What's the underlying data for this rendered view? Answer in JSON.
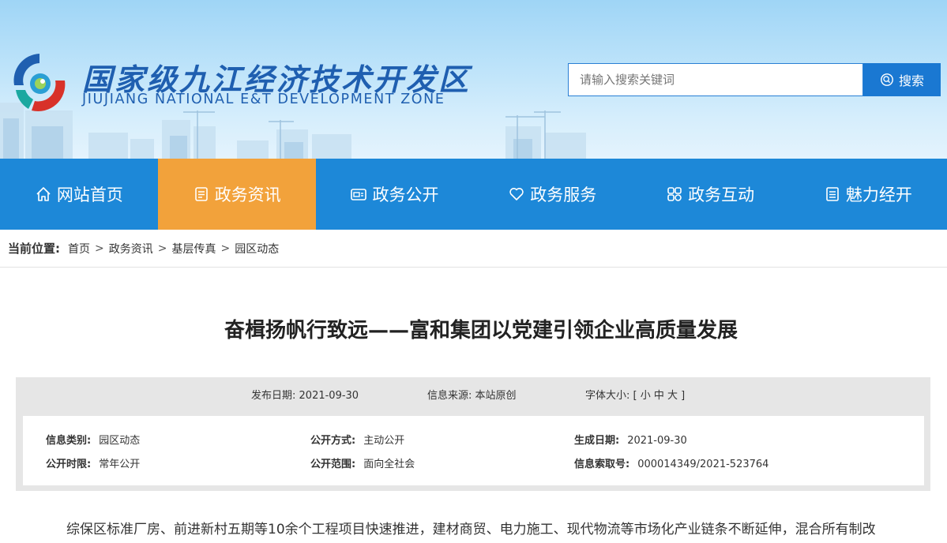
{
  "header": {
    "logo_cn": "国家级九江经济技术开发区",
    "logo_en": "JIUJIANG NATIONAL E&T DEVELOPMENT ZONE",
    "search_placeholder": "请输入搜索关键词",
    "search_button": "搜索"
  },
  "nav": {
    "items": [
      {
        "label": "网站首页",
        "icon": "home-icon"
      },
      {
        "label": "政务资讯",
        "icon": "document-icon",
        "active": true
      },
      {
        "label": "政务公开",
        "icon": "folder-icon"
      },
      {
        "label": "政务服务",
        "icon": "heart-icon"
      },
      {
        "label": "政务互动",
        "icon": "interact-icon"
      },
      {
        "label": "魅力经开",
        "icon": "list-icon"
      }
    ],
    "colors": {
      "bar": "#1d88d8",
      "active": "#f2a23b"
    }
  },
  "breadcrumb": {
    "label": "当前位置:",
    "items": [
      "首页",
      "政务资讯",
      "基层传真",
      "园区动态"
    ],
    "separator": ">"
  },
  "article": {
    "title": "奋楫扬帆行致远——富和集团以党建引领企业高质量发展",
    "meta": {
      "date_label": "发布日期:",
      "date": "2021-09-30",
      "source_label": "信息来源:",
      "source": "本站原创",
      "font_label": "字体大小:",
      "font_options": "[ 小 中 大 ]"
    },
    "info": {
      "category_label": "信息类别:",
      "category": "园区动态",
      "open_mode_label": "公开方式:",
      "open_mode": "主动公开",
      "gen_date_label": "生成日期:",
      "gen_date": "2021-09-30",
      "open_period_label": "公开时限:",
      "open_period": "常年公开",
      "open_scope_label": "公开范围:",
      "open_scope": "面向全社会",
      "index_label": "信息索取号:",
      "index_no": "000014349/2021-523764"
    },
    "body_first_line": "综保区标准厂房、前进新村五期等10余个工程项目快速推进，建材商贸、电力施工、现代物流等市场化产业链条不断延伸，混合所有制改"
  }
}
